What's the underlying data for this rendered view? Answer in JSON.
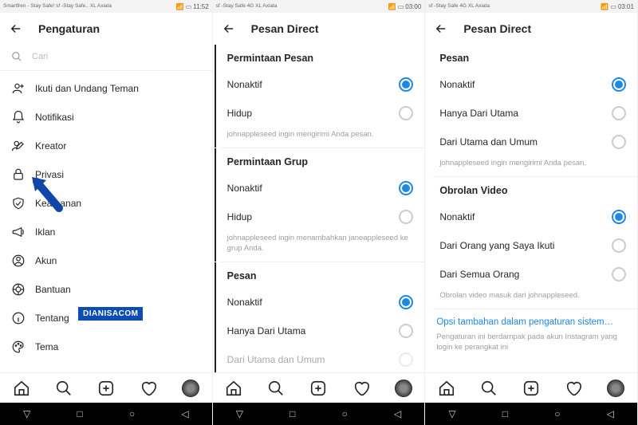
{
  "panels": [
    {
      "status": {
        "carrier": "Smartfren - Stay Safe! sf -Stay Safe..\nXL Axiata",
        "time": "11:52"
      },
      "appbar": {
        "title": "Pengaturan"
      },
      "search": {
        "placeholder": "Cari"
      },
      "menu": [
        {
          "label": "Ikuti dan Undang Teman",
          "icon": "add-friend"
        },
        {
          "label": "Notifikasi",
          "icon": "bell"
        },
        {
          "label": "Kreator",
          "icon": "creator"
        },
        {
          "label": "Privasi",
          "icon": "lock"
        },
        {
          "label": "Keamanan",
          "icon": "shield"
        },
        {
          "label": "Iklan",
          "icon": "megaphone"
        },
        {
          "label": "Akun",
          "icon": "account"
        },
        {
          "label": "Bantuan",
          "icon": "help"
        },
        {
          "label": "Tentang",
          "icon": "info"
        },
        {
          "label": "Tema",
          "icon": "palette"
        }
      ],
      "watermark": "DIANISACOM"
    },
    {
      "status": {
        "carrier": "sf -Stay Safe 4G\nXL Axiata",
        "time": "03:00"
      },
      "appbar": {
        "title": "Pesan Direct"
      },
      "sections": [
        {
          "title": "Permintaan Pesan",
          "options": [
            {
              "label": "Nonaktif",
              "selected": true
            },
            {
              "label": "Hidup",
              "selected": false
            }
          ],
          "helper": "johnappleseed ingin mengirimi Anda pesan."
        },
        {
          "title": "Permintaan Grup",
          "options": [
            {
              "label": "Nonaktif",
              "selected": true
            },
            {
              "label": "Hidup",
              "selected": false
            }
          ],
          "helper": "johnappleseed ingin menambahkan janeappleseed ke grup Anda."
        },
        {
          "title": "Pesan",
          "options": [
            {
              "label": "Nonaktif",
              "selected": true
            },
            {
              "label": "Hanya Dari Utama",
              "selected": false
            },
            {
              "label": "Dari Utama dan Umum",
              "selected": false
            }
          ]
        }
      ]
    },
    {
      "status": {
        "carrier": "sf -Stay Safe 4G\nXL Axiata",
        "time": "03:01"
      },
      "appbar": {
        "title": "Pesan Direct"
      },
      "sections": [
        {
          "title": "Pesan",
          "options": [
            {
              "label": "Nonaktif",
              "selected": true
            },
            {
              "label": "Hanya Dari Utama",
              "selected": false
            },
            {
              "label": "Dari Utama dan Umum",
              "selected": false
            }
          ],
          "helper": "johnappleseed ingin mengirimi Anda pesan."
        },
        {
          "title": "Obrolan Video",
          "options": [
            {
              "label": "Nonaktif",
              "selected": true
            },
            {
              "label": "Dari Orang yang Saya Ikuti",
              "selected": false
            },
            {
              "label": "Dari Semua Orang",
              "selected": false
            }
          ],
          "helper": "Obrolan video masuk dari johnappleseed."
        }
      ],
      "extra": {
        "link": "Opsi tambahan dalam pengaturan sistem…",
        "helper": "Pengaturan ini berdampak pada akun Instagram yang login ke perangkat ini"
      }
    }
  ],
  "accent": "#1e88e5"
}
